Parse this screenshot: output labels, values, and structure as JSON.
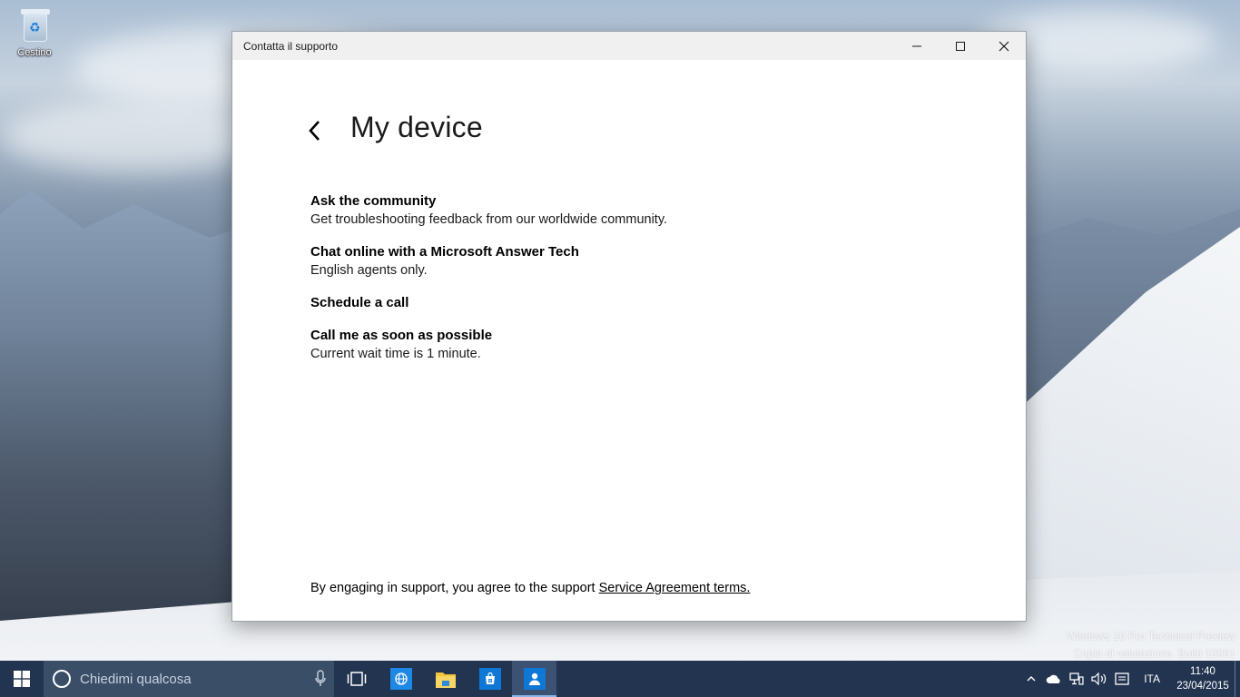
{
  "desktop": {
    "icons": [
      {
        "label": "Cestino",
        "icon": "recycle-bin-icon"
      }
    ],
    "watermark": {
      "line1": "Windows 10 Pro Technical Preview",
      "line2": "Copia di valutazione. Build 10061"
    }
  },
  "window": {
    "title": "Contatta il supporto",
    "controls": [
      "minimize-icon",
      "maximize-icon",
      "close-icon"
    ],
    "page_title": "My device",
    "options": [
      {
        "title": "Ask the community",
        "description": "Get troubleshooting feedback from our worldwide community."
      },
      {
        "title": "Chat online with a Microsoft Answer Tech",
        "description": "English agents only."
      },
      {
        "title": "Schedule a call",
        "description": ""
      },
      {
        "title": "Call me as soon as possible",
        "description": "Current wait time is 1 minute."
      }
    ],
    "footer_text": "By engaging in support, you agree to the support ",
    "footer_link": "Service Agreement terms."
  },
  "taskbar": {
    "search_placeholder": "Chiedimi qualcosa",
    "pinned": [
      "task-view-icon",
      "ie-icon",
      "file-explorer-icon",
      "store-icon",
      "contact-support-icon"
    ],
    "active_app": "contact-support-icon",
    "tray": {
      "icons": [
        "chevron-up-icon",
        "onedrive-icon",
        "network-icon",
        "volume-icon",
        "action-center-icon"
      ],
      "language": "ITA",
      "time": "11:40",
      "date": "23/04/2015"
    }
  },
  "colors": {
    "taskbar": "#223450",
    "search_box": "#3a4e68",
    "window_bg": "#ffffff",
    "titlebar": "#f0f0f0"
  }
}
